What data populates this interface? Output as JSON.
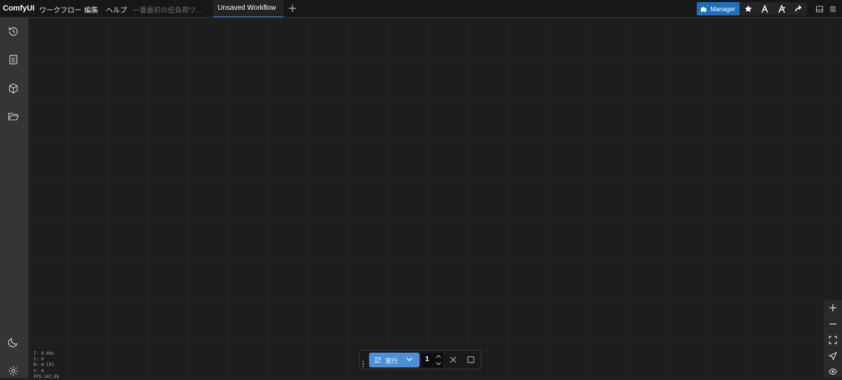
{
  "app": {
    "name": "ComfyUI"
  },
  "menu": {
    "workflow": "ワークフロー",
    "edit": "編集",
    "help": "ヘルプ"
  },
  "tabs": [
    {
      "label": "一番最初の低負荷ワ...",
      "active": false
    },
    {
      "label": "Unsaved Workflow",
      "active": true
    }
  ],
  "toolbar": {
    "manager_label": "Manager",
    "accent": "#1f6fbf"
  },
  "sidebar_icons": [
    "history-icon",
    "queue-list-icon",
    "model-library-icon",
    "workflows-folder-icon",
    "theme-moon-icon",
    "settings-gear-icon"
  ],
  "stats": {
    "t": "T: 0.00s",
    "i": "I: 0",
    "n": "N: 0 [0]",
    "v": "V: 0",
    "fps": "FPS:147.06"
  },
  "run": {
    "label": "実行",
    "count": "1",
    "color": "#4a8fd9"
  }
}
